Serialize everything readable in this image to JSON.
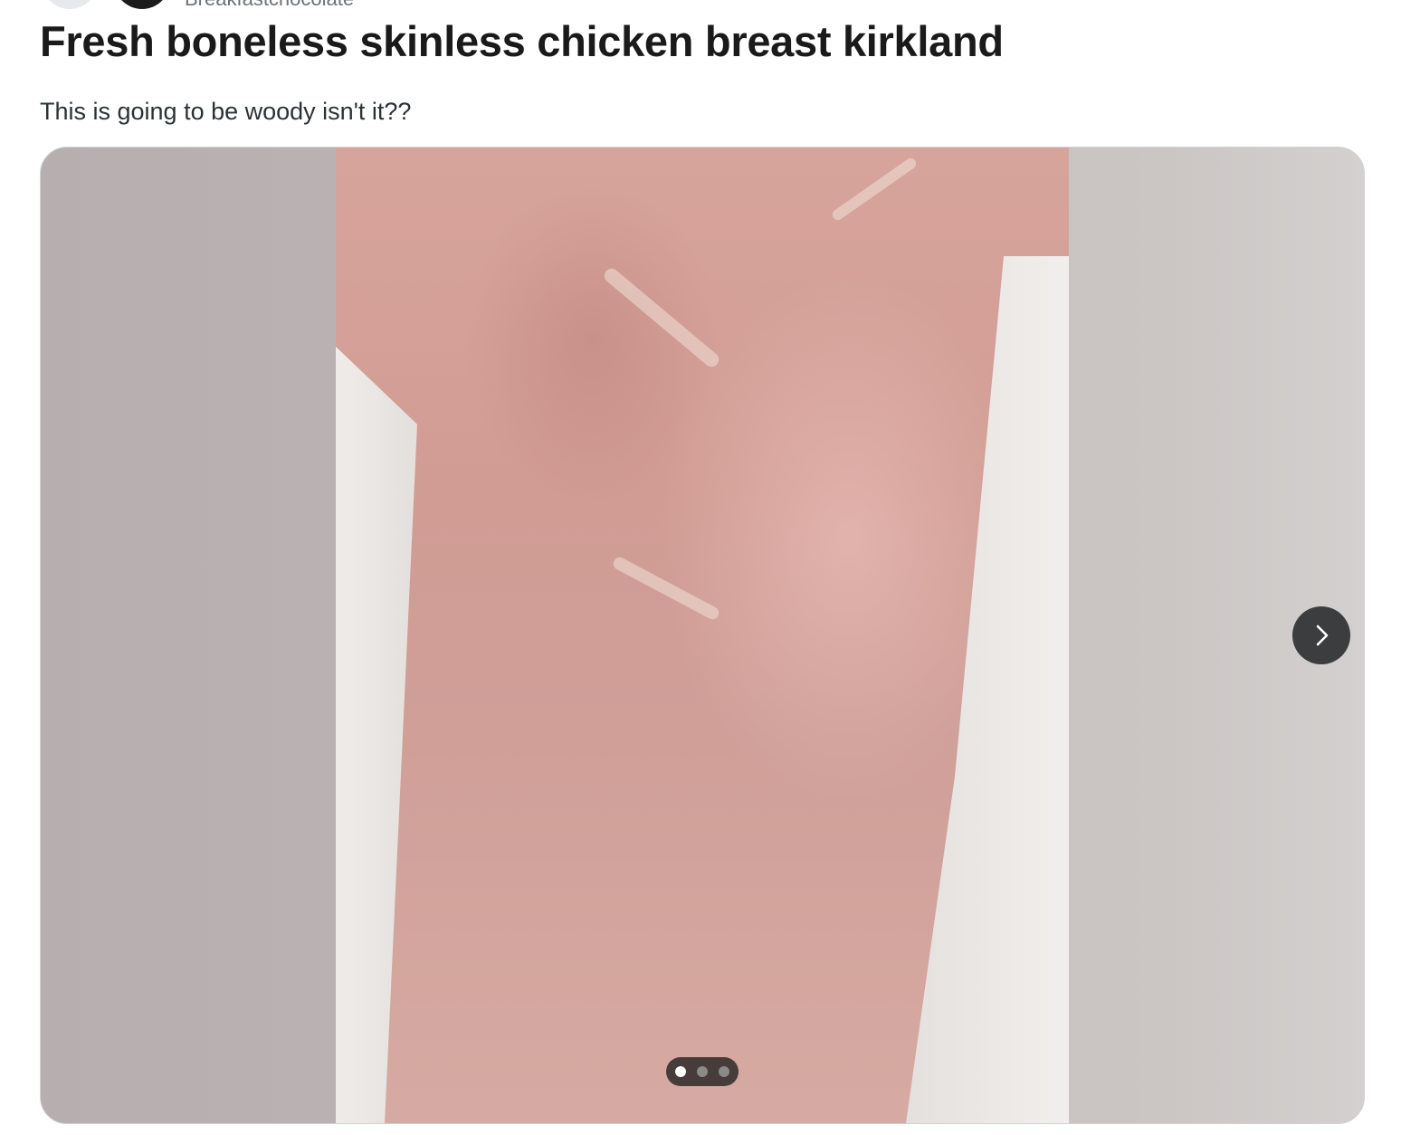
{
  "header": {
    "username": "Breakfastchocolate"
  },
  "post": {
    "title": "Fresh boneless skinless chicken breast kirkland",
    "body": "This is going to be woody isn't it??"
  },
  "gallery": {
    "image_description": "raw chicken breast on paper towel",
    "total_images": 3,
    "current_index": 1
  },
  "icons": {
    "next": "chevron-right-icon"
  }
}
